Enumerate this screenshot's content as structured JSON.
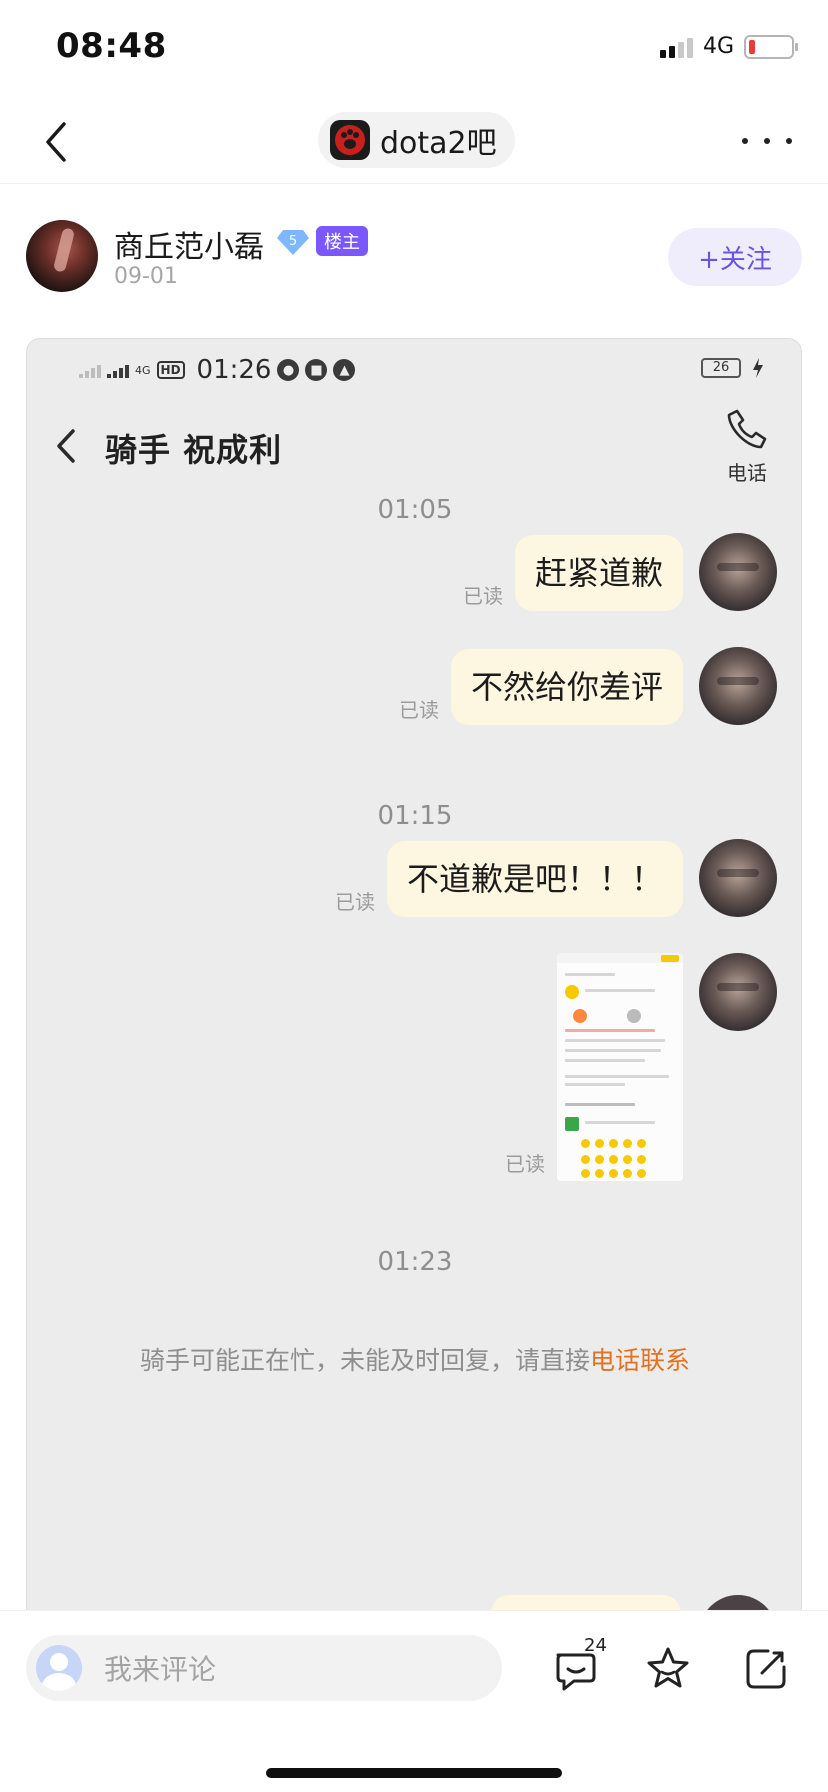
{
  "status_bar": {
    "time": "08:48",
    "network": "4G"
  },
  "nav": {
    "forum_name": "dota2吧"
  },
  "post": {
    "author": "商丘范小磊",
    "level": "5",
    "owner_badge": "楼主",
    "date": "09-01",
    "follow_label": "+关注"
  },
  "screenshot": {
    "status": {
      "network": "4G",
      "hd": "HD",
      "time": "01:26",
      "battery": "26"
    },
    "chat_title": "骑手 祝成利",
    "call_label": "电话",
    "timestamps": [
      "01:05",
      "01:15",
      "01:23"
    ],
    "read_label": "已读",
    "messages": [
      {
        "text": "赶紧道歉",
        "status": "已读"
      },
      {
        "text": "不然给你差评",
        "status": "已读"
      },
      {
        "text": "不道歉是吧！！！",
        "status": "已读"
      },
      {
        "text": "",
        "status": "已读",
        "kind": "image"
      }
    ],
    "notice": {
      "text": "骑手可能正在忙，未能及时回复，请直接",
      "highlight": "电话联系"
    }
  },
  "bottom": {
    "comment_placeholder": "我来评论",
    "comment_count": "24"
  },
  "colors": {
    "accent": "#7a57ff",
    "follow_text": "#6a53e0",
    "bubble": "#fdf7e2",
    "highlight": "#e1721f"
  }
}
